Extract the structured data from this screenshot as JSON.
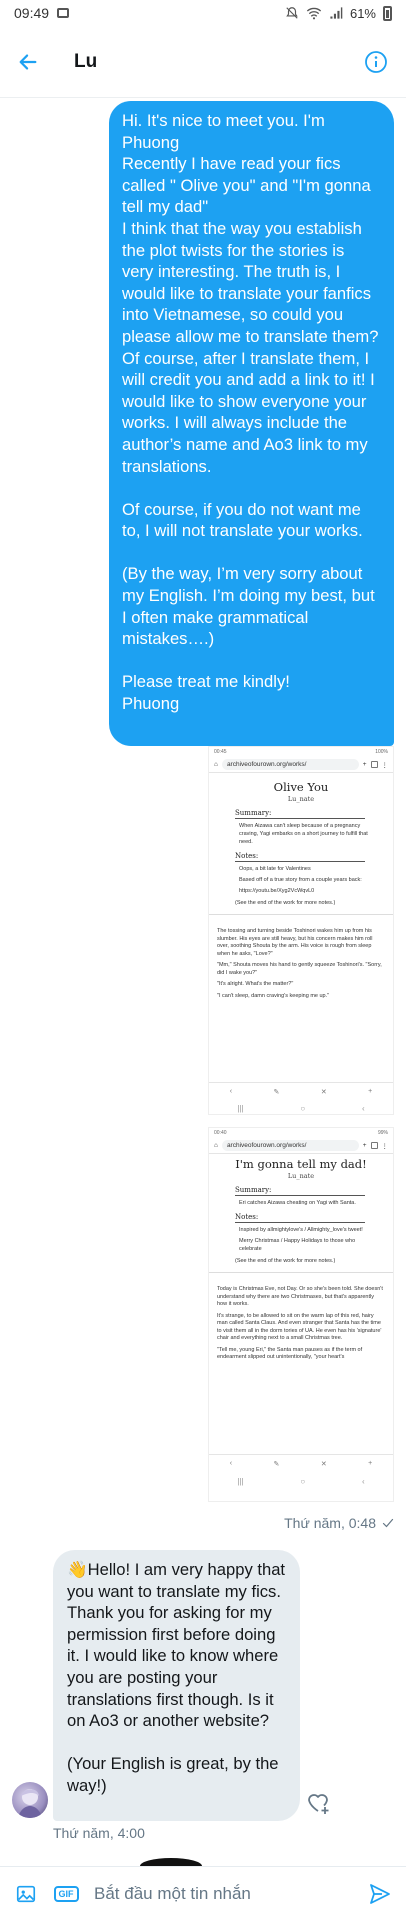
{
  "status_bar": {
    "time": "09:49",
    "battery": "61%"
  },
  "header": {
    "title": "Lu"
  },
  "messages": {
    "outgoing": {
      "paragraphs": [
        "Hi. It's nice to meet you. I'm Phuong\nRecently I have read your fics called \" Olive you\" and \"I'm gonna tell my dad\"\nI think that the way you establish the plot twists for the stories is very interesting. The truth is, I would like to translate your fanfics into Vietnamese, so could you please allow me to translate them? Of course, after I translate them, I will credit you and add a link to it! I would like to show everyone your works. I will always include the author’s name and Ao3 link to my translations.",
        "Of course, if you do not want me to, I will not translate your works.",
        "(By the way, I’m very sorry about my English. I’m doing my best, but I often make grammatical mistakes….)",
        "Please treat me kindly!\nPhuong"
      ],
      "timestamp": "Thứ năm, 0:48"
    },
    "screenshot1": {
      "status_time": "00:45",
      "status_right": "100%",
      "url": "archiveofourown.org/works/",
      "title": "Olive You",
      "author": "Lu_nate",
      "summary_heading": "Summary:",
      "summary": "When Aizawa can't sleep because of a pregnancy craving, Yagi embarks on a short journey to fulfill that need.",
      "notes_heading": "Notes:",
      "notes1": "Oops, a bit late for Valentines",
      "notes2": "Based off of a true story from a couple years back:",
      "notes_link": "https://youtu.be/Xyg2VcWqvL0",
      "see_end": "(See the end of the work for more notes.)",
      "p1": "The tossing and turning beside Toshinori wakes him up from his slumber. His eyes are still heavy, but his concern makes him roll over, soothing Shouta by the arm. His voice is rough from sleep when he asks, \"Love?\"",
      "p2": "\"Mm,\" Shouta moves his hand to gently squeeze Toshinori's. \"Sorry, did I wake you?\"",
      "p3": "\"It's alright. What's the matter?\"",
      "p4": "\"I can't sleep, damn craving's keeping me up.\""
    },
    "screenshot2": {
      "status_time": "00:40",
      "status_right": "99%",
      "url": "archiveofourown.org/works/",
      "title": "I'm gonna tell my dad!",
      "author": "Lu_nate",
      "summary_heading": "Summary:",
      "summary": "Eri catches Aizawa cheating on Yagi with Santa.",
      "notes_heading": "Notes:",
      "notes1": "Inspired by allmightylove's / Allmighty_love's tweet!",
      "notes2": "Merry Christmas / Happy Holidays to those who celebrate",
      "see_end": "(See the end of the work for more notes.)",
      "p1": "Today is Christmas Eve, not Day. Or so she's been told. She doesn't understand why there are two Christmases, but that's apparently how it works.",
      "p2": "It's strange, to be allowed to sit on the warm lap of this red, hairy man called Santa Claus. And even stranger that Santa has the time to visit them all in the dorm tories of UA. He even has his 'signature' chair and everything next to a small Christmas tree.",
      "p3": "\"Tell me, young Eri,\" the Santa man pauses as if the term of endearment slipped out unintentionally, \"your heart's"
    },
    "incoming": {
      "paragraphs": [
        "👋Hello! I am very happy that you want to translate my fics. Thank you for asking for my permission first before doing it. I would like to know where you are posting your translations first though. Is it on Ao3 or another website?",
        "(Your English is great, by the way!)"
      ],
      "timestamp": "Thứ năm, 4:00"
    }
  },
  "composer": {
    "placeholder": "Bắt đầu một tin nhắn",
    "gif_label": "GIF"
  },
  "colors": {
    "accent": "#1da1f2",
    "incoming_bubble": "#e6ecf0",
    "meta_text": "#657786"
  }
}
